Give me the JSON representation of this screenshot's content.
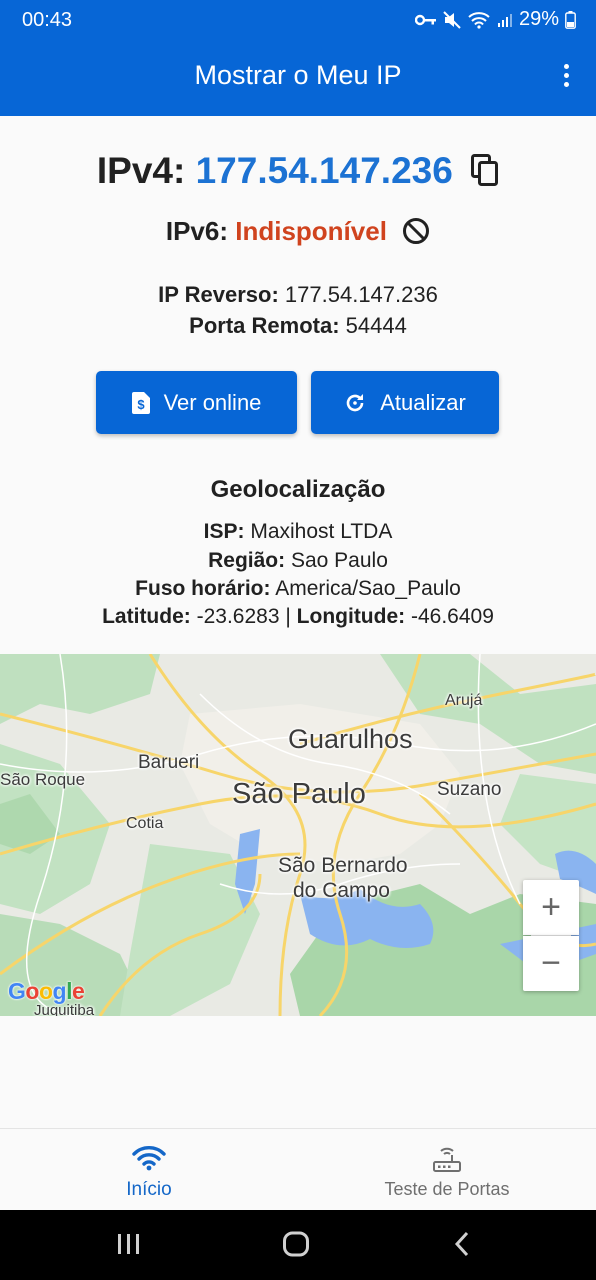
{
  "status_bar": {
    "time": "00:43",
    "battery": "29%"
  },
  "app_bar": {
    "title": "Mostrar o Meu IP"
  },
  "ipv4": {
    "label": "IPv4:",
    "value": "177.54.147.236"
  },
  "ipv6": {
    "label": "IPv6:",
    "value": "Indisponível"
  },
  "reverse": {
    "label": "IP Reverso:",
    "value": "177.54.147.236"
  },
  "port": {
    "label": "Porta Remota:",
    "value": "54444"
  },
  "buttons": {
    "online": "Ver online",
    "update": "Atualizar"
  },
  "geo": {
    "title": "Geolocalização",
    "isp_label": "ISP:",
    "isp": "Maxihost LTDA",
    "region_label": "Região:",
    "region": "Sao Paulo",
    "tz_label": "Fuso horário:",
    "tz": "America/Sao_Paulo",
    "lat_label": "Latitude:",
    "lat": "-23.6283",
    "sep": "|",
    "lon_label": "Longitude:",
    "lon": "-46.6409"
  },
  "map": {
    "cities": {
      "aruja": "Arujá",
      "guarulhos": "Guarulhos",
      "barueri": "Barueri",
      "sao_roque": "São Roque",
      "sao_paulo": "São Paulo",
      "suzano": "Suzano",
      "cotia": "Cotia",
      "sbc_1": "São Bernardo",
      "sbc_2": "do Campo",
      "juquitiba": "Juquitiba"
    },
    "zoom_in": "+",
    "zoom_out": "−",
    "logo": [
      "G",
      "o",
      "o",
      "g",
      "l",
      "e"
    ]
  },
  "bottom_nav": {
    "home": "Início",
    "ports": "Teste de Portas"
  },
  "colors": {
    "primary": "#0766d6",
    "ipv4": "#1c72d3",
    "ipv6_unavailable": "#d0431e"
  }
}
